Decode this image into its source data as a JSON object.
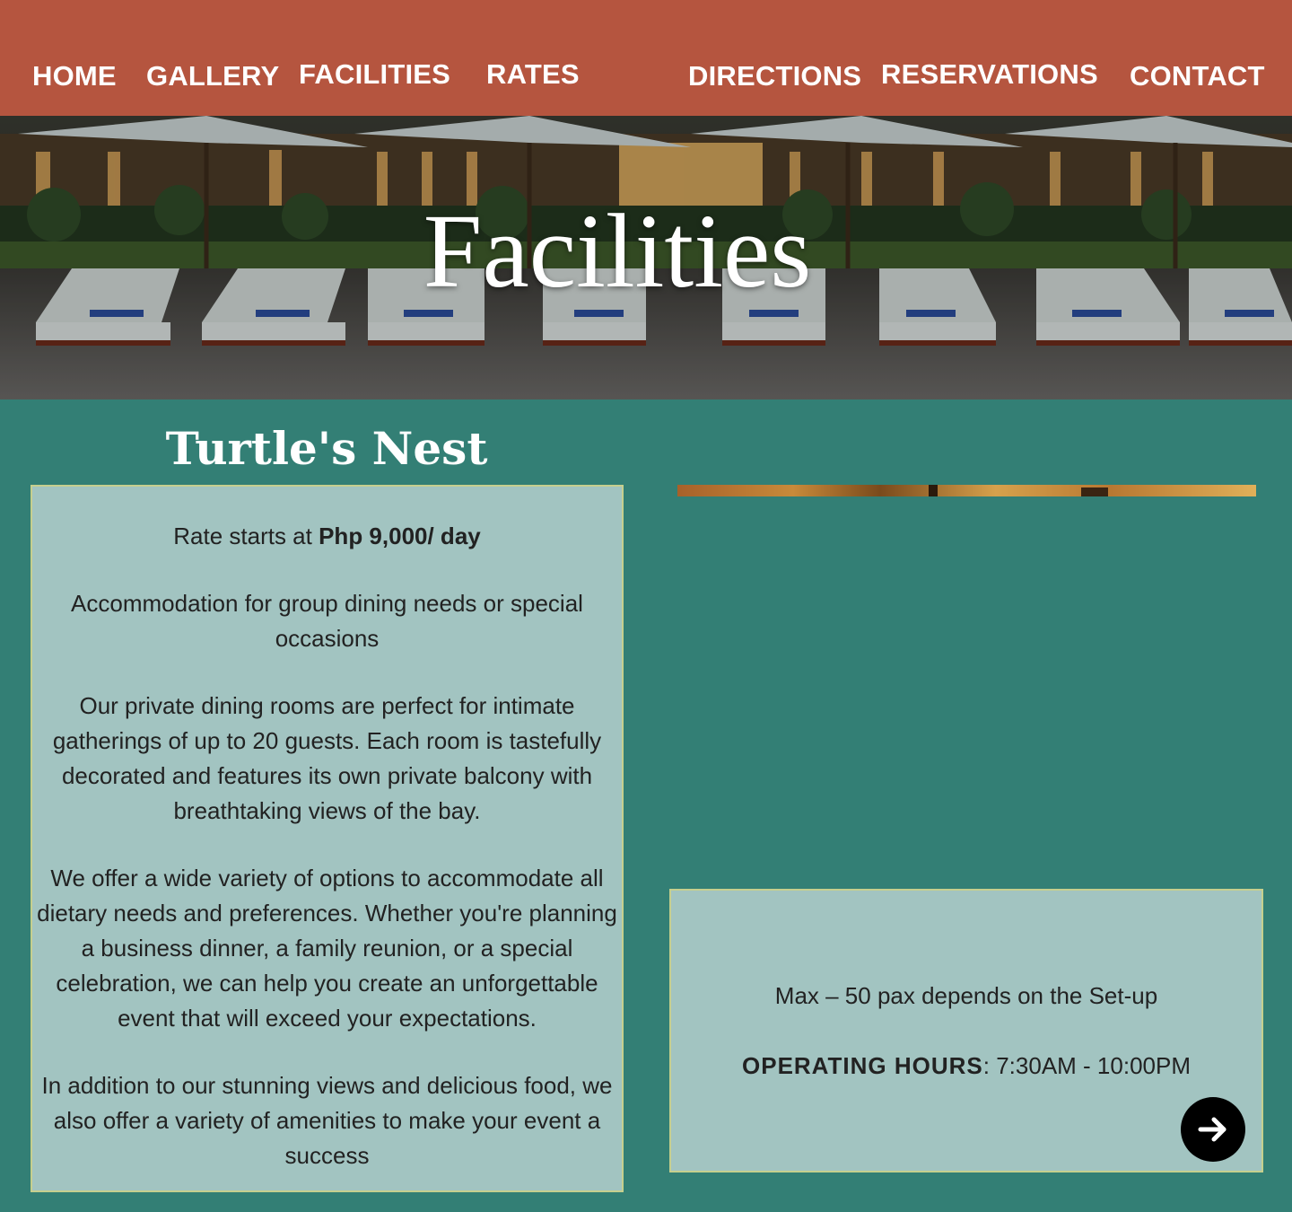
{
  "nav": {
    "items": [
      {
        "label": "HOME"
      },
      {
        "label": "GALLERY"
      },
      {
        "label": "FACILITIES"
      },
      {
        "label": "RATES"
      },
      {
        "label": "DIRECTIONS"
      },
      {
        "label": "RESERVATIONS"
      },
      {
        "label": "CONTACT"
      }
    ],
    "bg_color": "#b5553f"
  },
  "hero": {
    "title": "Facilities"
  },
  "facility": {
    "name": "Turtle's Nest",
    "rate_prefix": "Rate starts at ",
    "rate_value": "Php 9,000/ day",
    "summary": "Accommodation for group dining needs or special occasions",
    "paragraph_1": "Our private dining rooms are perfect for intimate gatherings of up to 20 guests. Each room is tastefully decorated and features its own private balcony with breathtaking views of the bay.",
    "paragraph_2": "We offer a wide variety of options to accommodate all dietary needs and preferences. Whether you're planning a business dinner, a family reunion, or a special celebration, we can help you create an unforgettable event that will exceed your expectations.",
    "paragraph_3": "In addition to our stunning views and delicious food, we also offer a variety of amenities to make your event a success",
    "capacity": "Max – 50 pax depends on the Set-up",
    "hours_label": "OPERATING HOURS",
    "hours_value": ": 7:30AM - 10:00PM",
    "next_icon": "arrow-right-icon"
  },
  "colors": {
    "page_bg": "#337f75",
    "card_bg": "#a2c4c1",
    "card_border": "#c6cf8e"
  }
}
